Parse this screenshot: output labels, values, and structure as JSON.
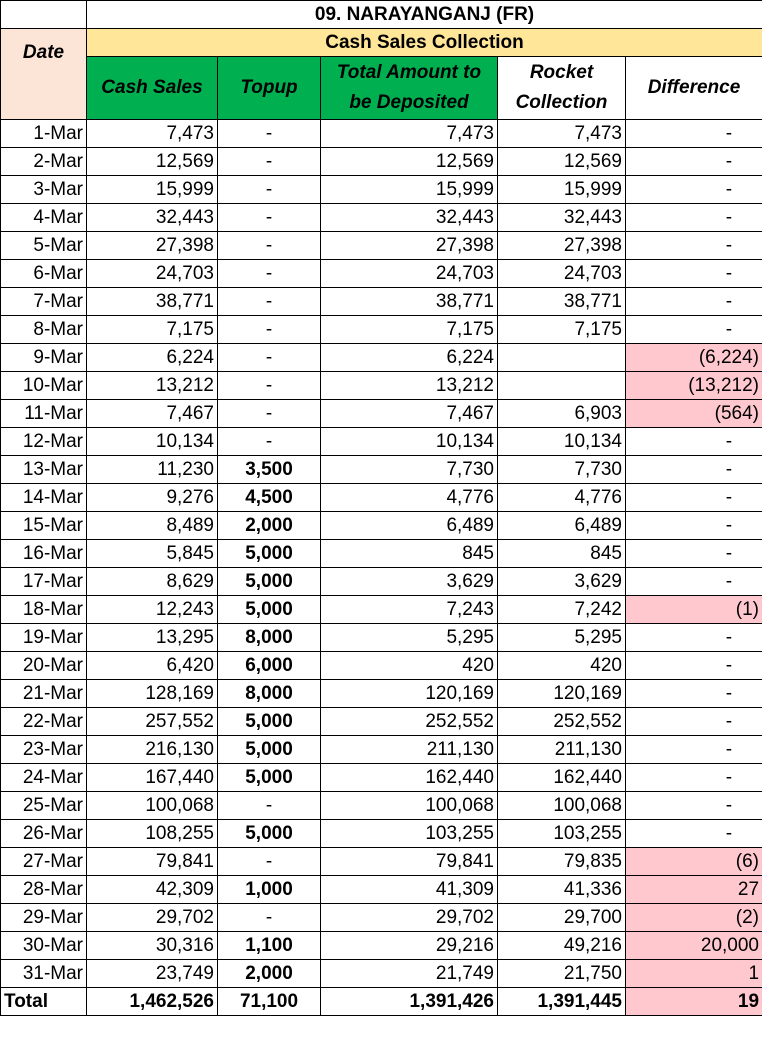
{
  "title": "09. NARAYANGANJ (FR)",
  "section_header": "Cash Sales Collection",
  "headers": {
    "date": "Date",
    "cash_sales": "Cash Sales",
    "topup": "Topup",
    "total_amount": "Total Amount to be Deposited",
    "rocket_collection": "Rocket Collection",
    "difference": "Difference"
  },
  "rows": [
    {
      "date": "1-Mar",
      "cash": "7,473",
      "topup": "-",
      "total": "7,473",
      "rocket": "7,473",
      "diff": "-",
      "flag": false
    },
    {
      "date": "2-Mar",
      "cash": "12,569",
      "topup": "-",
      "total": "12,569",
      "rocket": "12,569",
      "diff": "-",
      "flag": false
    },
    {
      "date": "3-Mar",
      "cash": "15,999",
      "topup": "-",
      "total": "15,999",
      "rocket": "15,999",
      "diff": "-",
      "flag": false
    },
    {
      "date": "4-Mar",
      "cash": "32,443",
      "topup": "-",
      "total": "32,443",
      "rocket": "32,443",
      "diff": "-",
      "flag": false
    },
    {
      "date": "5-Mar",
      "cash": "27,398",
      "topup": "-",
      "total": "27,398",
      "rocket": "27,398",
      "diff": "-",
      "flag": false
    },
    {
      "date": "6-Mar",
      "cash": "24,703",
      "topup": "-",
      "total": "24,703",
      "rocket": "24,703",
      "diff": "-",
      "flag": false
    },
    {
      "date": "7-Mar",
      "cash": "38,771",
      "topup": "-",
      "total": "38,771",
      "rocket": "38,771",
      "diff": "-",
      "flag": false
    },
    {
      "date": "8-Mar",
      "cash": "7,175",
      "topup": "-",
      "total": "7,175",
      "rocket": "7,175",
      "diff": "-",
      "flag": false
    },
    {
      "date": "9-Mar",
      "cash": "6,224",
      "topup": "-",
      "total": "6,224",
      "rocket": "",
      "diff": "(6,224)",
      "flag": true
    },
    {
      "date": "10-Mar",
      "cash": "13,212",
      "topup": "-",
      "total": "13,212",
      "rocket": "",
      "diff": "(13,212)",
      "flag": true
    },
    {
      "date": "11-Mar",
      "cash": "7,467",
      "topup": "-",
      "total": "7,467",
      "rocket": "6,903",
      "diff": "(564)",
      "flag": true
    },
    {
      "date": "12-Mar",
      "cash": "10,134",
      "topup": "-",
      "total": "10,134",
      "rocket": "10,134",
      "diff": "-",
      "flag": false
    },
    {
      "date": "13-Mar",
      "cash": "11,230",
      "topup": "3,500",
      "total": "7,730",
      "rocket": "7,730",
      "diff": "-",
      "flag": false
    },
    {
      "date": "14-Mar",
      "cash": "9,276",
      "topup": "4,500",
      "total": "4,776",
      "rocket": "4,776",
      "diff": "-",
      "flag": false
    },
    {
      "date": "15-Mar",
      "cash": "8,489",
      "topup": "2,000",
      "total": "6,489",
      "rocket": "6,489",
      "diff": "-",
      "flag": false
    },
    {
      "date": "16-Mar",
      "cash": "5,845",
      "topup": "5,000",
      "total": "845",
      "rocket": "845",
      "diff": "-",
      "flag": false
    },
    {
      "date": "17-Mar",
      "cash": "8,629",
      "topup": "5,000",
      "total": "3,629",
      "rocket": "3,629",
      "diff": "-",
      "flag": false
    },
    {
      "date": "18-Mar",
      "cash": "12,243",
      "topup": "5,000",
      "total": "7,243",
      "rocket": "7,242",
      "diff": "(1)",
      "flag": true
    },
    {
      "date": "19-Mar",
      "cash": "13,295",
      "topup": "8,000",
      "total": "5,295",
      "rocket": "5,295",
      "diff": "-",
      "flag": false
    },
    {
      "date": "20-Mar",
      "cash": "6,420",
      "topup": "6,000",
      "total": "420",
      "rocket": "420",
      "diff": "-",
      "flag": false
    },
    {
      "date": "21-Mar",
      "cash": "128,169",
      "topup": "8,000",
      "total": "120,169",
      "rocket": "120,169",
      "diff": "-",
      "flag": false
    },
    {
      "date": "22-Mar",
      "cash": "257,552",
      "topup": "5,000",
      "total": "252,552",
      "rocket": "252,552",
      "diff": "-",
      "flag": false
    },
    {
      "date": "23-Mar",
      "cash": "216,130",
      "topup": "5,000",
      "total": "211,130",
      "rocket": "211,130",
      "diff": "-",
      "flag": false
    },
    {
      "date": "24-Mar",
      "cash": "167,440",
      "topup": "5,000",
      "total": "162,440",
      "rocket": "162,440",
      "diff": "-",
      "flag": false
    },
    {
      "date": "25-Mar",
      "cash": "100,068",
      "topup": "-",
      "total": "100,068",
      "rocket": "100,068",
      "diff": "-",
      "flag": false
    },
    {
      "date": "26-Mar",
      "cash": "108,255",
      "topup": "5,000",
      "total": "103,255",
      "rocket": "103,255",
      "diff": "-",
      "flag": false
    },
    {
      "date": "27-Mar",
      "cash": "79,841",
      "topup": "-",
      "total": "79,841",
      "rocket": "79,835",
      "diff": "(6)",
      "flag": true
    },
    {
      "date": "28-Mar",
      "cash": "42,309",
      "topup": "1,000",
      "total": "41,309",
      "rocket": "41,336",
      "diff": "27",
      "flag": true
    },
    {
      "date": "29-Mar",
      "cash": "29,702",
      "topup": "-",
      "total": "29,702",
      "rocket": "29,700",
      "diff": "(2)",
      "flag": true
    },
    {
      "date": "30-Mar",
      "cash": "30,316",
      "topup": "1,100",
      "total": "29,216",
      "rocket": "49,216",
      "diff": "20,000",
      "flag": true
    },
    {
      "date": "31-Mar",
      "cash": "23,749",
      "topup": "2,000",
      "total": "21,749",
      "rocket": "21,750",
      "diff": "1",
      "flag": true
    }
  ],
  "total": {
    "label": "Total",
    "cash": "1,462,526",
    "topup": "71,100",
    "total": "1,391,426",
    "rocket": "1,391,445",
    "diff": "19"
  },
  "colors": {
    "section_header_bg": "#ffe699",
    "date_header_bg": "#fce4d6",
    "green_header_bg": "#00b050",
    "topup_text": "#ed7d31",
    "diff_bg": "#ffc7ce",
    "diff_text": "#9c0006"
  }
}
